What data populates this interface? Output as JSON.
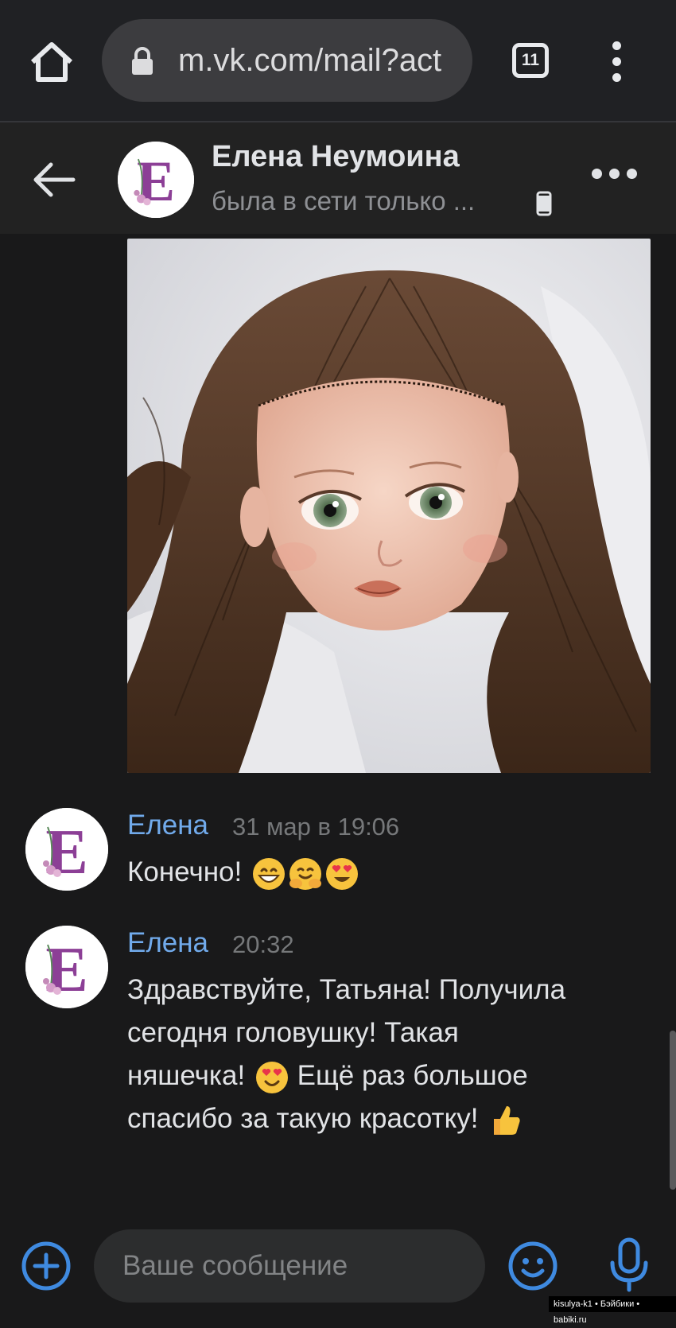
{
  "browser": {
    "url": "m.vk.com/mail?act",
    "tab_count": "11"
  },
  "header": {
    "contact_name": "Елена Неумоина",
    "status": "была в сети только ..."
  },
  "messages": [
    {
      "author": "Елена",
      "time": "31 мар в 19:06",
      "lines": [
        "Конечно!"
      ],
      "emojis": [
        "grin-emoji",
        "hug-emoji",
        "heart-eyes-emoji"
      ]
    },
    {
      "author": "Елена",
      "time": "20:32",
      "lines": [
        "Здравствуйте, Татьяна! Получила",
        "сегодня головушку! Такая",
        "няшечка!",
        "Ещё раз большое",
        "спасибо за такую красотку!"
      ]
    }
  ],
  "composer": {
    "placeholder": "Ваше сообщение"
  },
  "watermark": "kisulya-k1 • Бэйбики • babiki.ru",
  "colors": {
    "background": "#19191a",
    "accent": "#71aaeb",
    "author": "#71aaeb",
    "header": "#222222"
  }
}
